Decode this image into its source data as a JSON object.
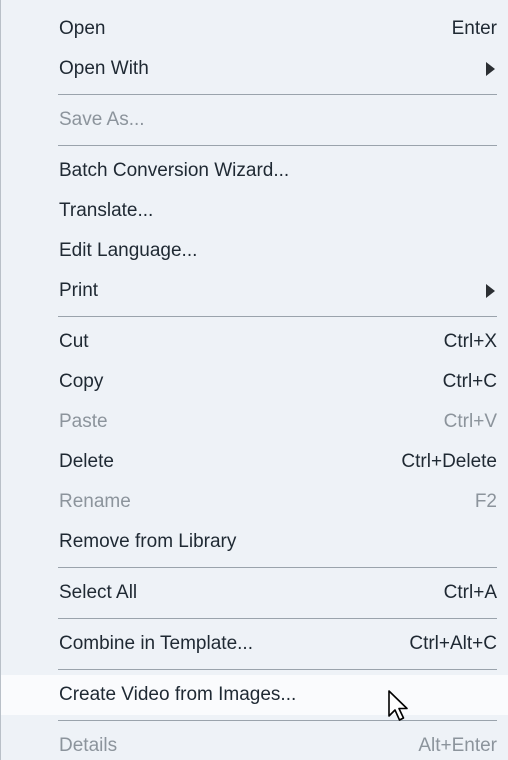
{
  "menu": {
    "groups": [
      {
        "items": [
          {
            "label": "Open",
            "shortcut": "Enter"
          },
          {
            "label": "Open With",
            "submenu": true
          }
        ]
      },
      {
        "items": [
          {
            "label": "Save As...",
            "disabled": true
          }
        ]
      },
      {
        "items": [
          {
            "label": "Batch Conversion Wizard..."
          },
          {
            "label": "Translate..."
          },
          {
            "label": "Edit Language..."
          },
          {
            "label": "Print",
            "submenu": true
          }
        ]
      },
      {
        "items": [
          {
            "label": "Cut",
            "shortcut": "Ctrl+X"
          },
          {
            "label": "Copy",
            "shortcut": "Ctrl+C"
          },
          {
            "label": "Paste",
            "shortcut": "Ctrl+V",
            "disabled": true
          },
          {
            "label": "Delete",
            "shortcut": "Ctrl+Delete"
          },
          {
            "label": "Rename",
            "shortcut": "F2",
            "disabled": true
          },
          {
            "label": "Remove from Library"
          }
        ]
      },
      {
        "items": [
          {
            "label": "Select All",
            "shortcut": "Ctrl+A"
          }
        ]
      },
      {
        "items": [
          {
            "label": "Combine in Template...",
            "shortcut": "Ctrl+Alt+C"
          }
        ]
      },
      {
        "items": [
          {
            "label": "Create Video from Images...",
            "hovered": true
          }
        ]
      },
      {
        "items": [
          {
            "label": "Details",
            "shortcut": "Alt+Enter",
            "disabled": true
          }
        ]
      }
    ]
  },
  "colors": {
    "menu_background": "#eef2f7",
    "hover_background": "#fafbfd",
    "text": "#1f2933",
    "disabled_text": "#8c949c",
    "separator": "#9aa3ac"
  },
  "icons": {
    "submenu": "submenu-arrow-icon",
    "cursor": "mouse-pointer-icon"
  }
}
